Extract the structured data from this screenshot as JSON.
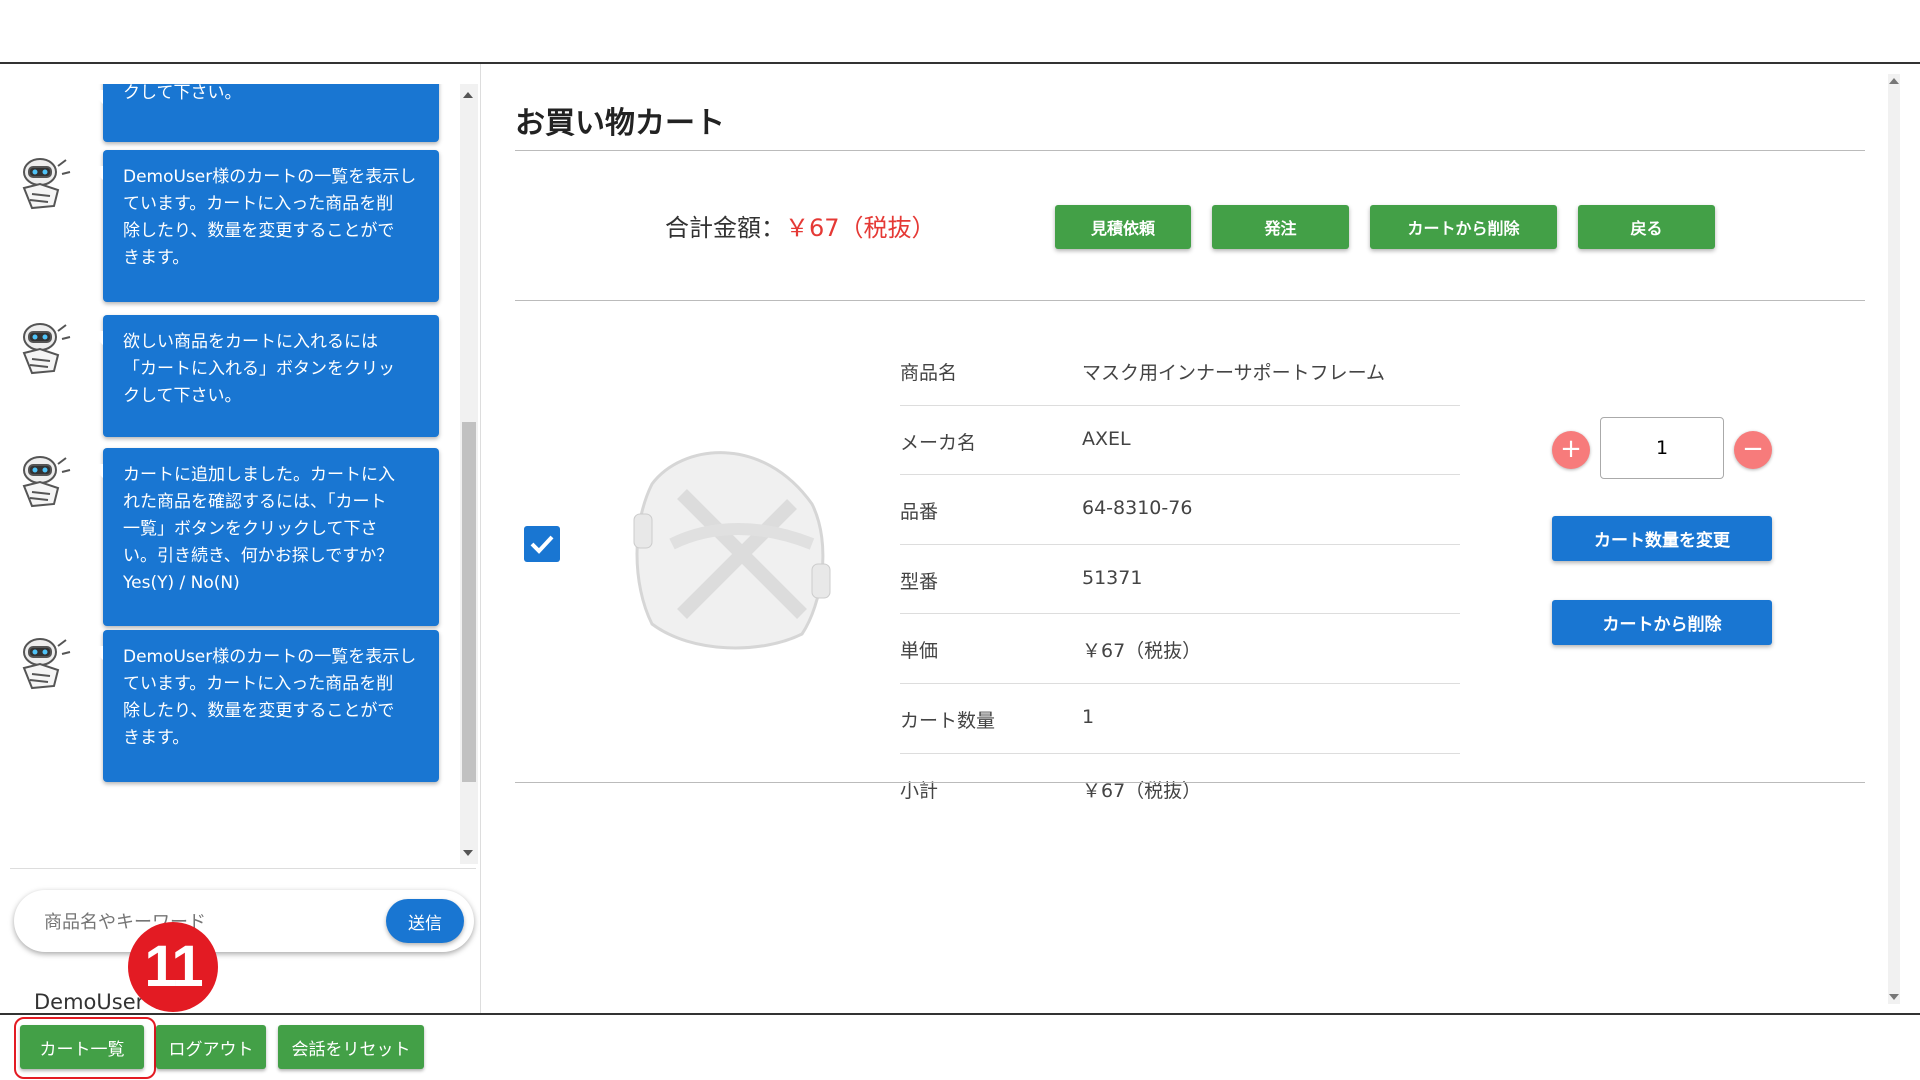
{
  "chat": {
    "messages": [
      {
        "text": "クして下さい。"
      },
      {
        "text": "DemoUser様のカートの一覧を表示し\nています。カートに入った商品を削\n除したり、数量を変更することがで\nきます。"
      },
      {
        "text": "欲しい商品をカートに入れるには\n「カートに入れる」ボタンをクリッ\nクして下さい。"
      },
      {
        "text": "カートに追加しました。カートに入\nれた商品を確認するには、「カート\n一覧」ボタンをクリックして下さ\nい。引き続き、何かお探しですか？\nYes(Y) / No(N)"
      },
      {
        "text": "DemoUser様のカートの一覧を表示し\nています。カートに入った商品を削\n除したり、数量を変更することがで\nきます。"
      }
    ],
    "input_placeholder": "商品名やキーワード",
    "send_label": "送信",
    "user_name": "DemoUser",
    "step_badge": "11",
    "buttons": {
      "cart_list": "カート一覧",
      "logout": "ログアウト",
      "reset": "会話をリセット"
    }
  },
  "main": {
    "title": "お買い物カート",
    "total_label": "合計金額：",
    "total_value": "￥67（税抜）",
    "actions": {
      "quote": "見積依頼",
      "order": "発注",
      "remove_from_cart": "カートから削除",
      "back": "戻る"
    },
    "item": {
      "checked": true,
      "details": [
        {
          "key": "商品名",
          "value": "マスク用インナーサポートフレーム"
        },
        {
          "key": "メーカ名",
          "value": "AXEL"
        },
        {
          "key": "品番",
          "value": "64-8310-76"
        },
        {
          "key": "型番",
          "value": "51371"
        },
        {
          "key": "単価",
          "value": "￥67（税抜）"
        },
        {
          "key": "カート数量",
          "value": "1"
        },
        {
          "key": "小計",
          "value": "￥67（税抜）"
        }
      ],
      "quantity": "1",
      "change_qty_label": "カート数量を変更",
      "remove_label": "カートから削除"
    }
  },
  "colors": {
    "primary_blue": "#1976d2",
    "green": "#43a047",
    "price_red": "#e53935",
    "badge_red": "#e31b23"
  }
}
